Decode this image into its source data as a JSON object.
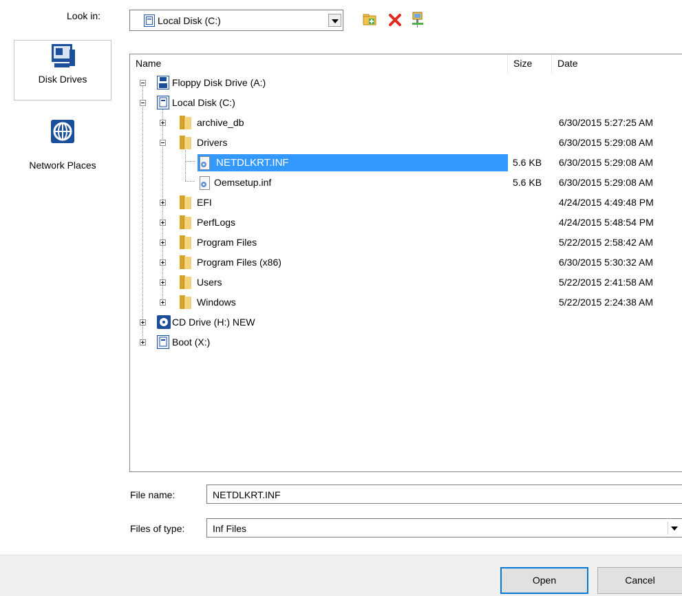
{
  "look_in": {
    "label": "Look in:",
    "value": "Local Disk (C:)"
  },
  "toolbar": {
    "new_folder_icon": "new-folder-icon",
    "delete_icon": "delete-icon",
    "network_icon": "network-computer-icon"
  },
  "places": [
    {
      "label": "Disk Drives",
      "icon": "disk-drives-icon",
      "selected": true
    },
    {
      "label": "Network Places",
      "icon": "network-places-icon",
      "selected": false
    }
  ],
  "columns": {
    "name": "Name",
    "size": "Size",
    "date": "Date"
  },
  "tree": [
    {
      "name": "Floppy Disk Drive (A:)",
      "size": "",
      "date": "",
      "icon": "floppy-icon"
    },
    {
      "name": "Local Disk (C:)",
      "size": "",
      "date": "",
      "icon": "local-disk-icon"
    },
    {
      "name": "archive_db",
      "size": "",
      "date": "6/30/2015 5:27:25 AM",
      "icon": "folder-icon"
    },
    {
      "name": "Drivers",
      "size": "",
      "date": "6/30/2015 5:29:08 AM",
      "icon": "folder-icon"
    },
    {
      "name": "NETDLKRT.INF",
      "size": "5.6 KB",
      "date": "6/30/2015 5:29:08 AM",
      "icon": "inf-file-icon",
      "selected": true
    },
    {
      "name": "Oemsetup.inf",
      "size": "5.6 KB",
      "date": "6/30/2015 5:29:08 AM",
      "icon": "inf-file-icon"
    },
    {
      "name": "EFI",
      "size": "",
      "date": "4/24/2015 4:49:48 PM",
      "icon": "folder-icon"
    },
    {
      "name": "PerfLogs",
      "size": "",
      "date": "4/24/2015 5:48:54 PM",
      "icon": "folder-icon"
    },
    {
      "name": "Program Files",
      "size": "",
      "date": "5/22/2015 2:58:42 AM",
      "icon": "folder-icon"
    },
    {
      "name": "Program Files (x86)",
      "size": "",
      "date": "6/30/2015 5:30:32 AM",
      "icon": "folder-icon"
    },
    {
      "name": "Users",
      "size": "",
      "date": "5/22/2015 2:41:58 AM",
      "icon": "folder-icon"
    },
    {
      "name": "Windows",
      "size": "",
      "date": "5/22/2015 2:24:38 AM",
      "icon": "folder-icon"
    },
    {
      "name": "CD Drive (H:) NEW",
      "size": "",
      "date": "",
      "icon": "cd-drive-icon"
    },
    {
      "name": "Boot (X:)",
      "size": "",
      "date": "",
      "icon": "boot-drive-icon"
    }
  ],
  "file_name": {
    "label": "File name:",
    "value": "NETDLKRT.INF"
  },
  "file_type": {
    "label": "Files of type:",
    "value": "Inf Files"
  },
  "buttons": {
    "open": "Open",
    "cancel": "Cancel"
  }
}
